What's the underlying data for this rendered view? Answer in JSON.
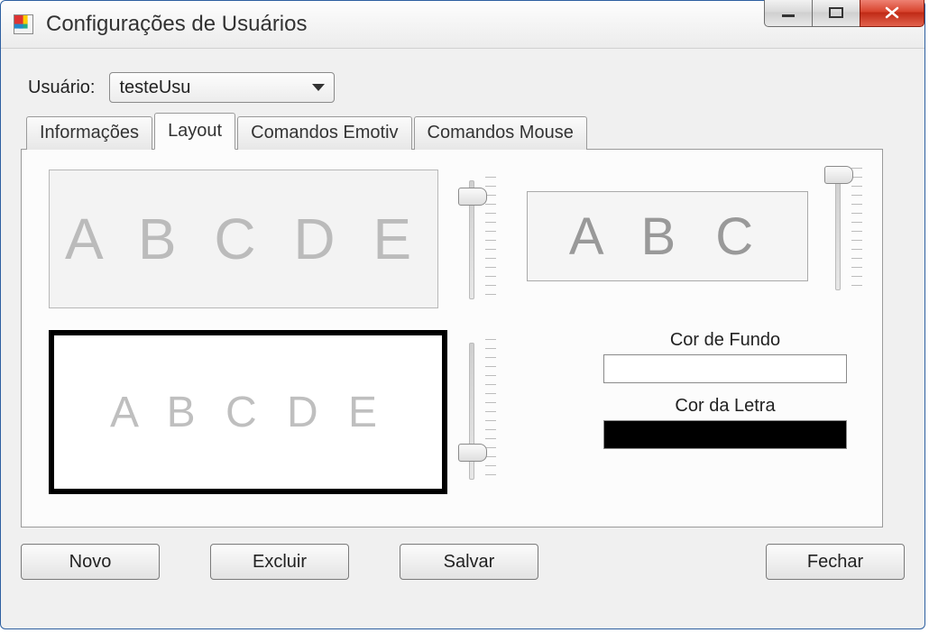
{
  "window": {
    "title": "Configurações de Usuários"
  },
  "user": {
    "label": "Usuário:",
    "value": "testeUsu"
  },
  "tabs": {
    "t0": "Informações",
    "t1": "Layout",
    "t2": "Comandos Emotiv",
    "t3": "Comandos Mouse",
    "active_index": 1
  },
  "previews": {
    "p1": "A B C D E",
    "p2": "A B C",
    "p3": "A B C D E"
  },
  "colors": {
    "bg_label": "Cor de Fundo",
    "bg_value": "#ffffff",
    "fg_label": "Cor da Letra",
    "fg_value": "#000000"
  },
  "buttons": {
    "novo": "Novo",
    "excluir": "Excluir",
    "salvar": "Salvar",
    "fechar": "Fechar"
  }
}
